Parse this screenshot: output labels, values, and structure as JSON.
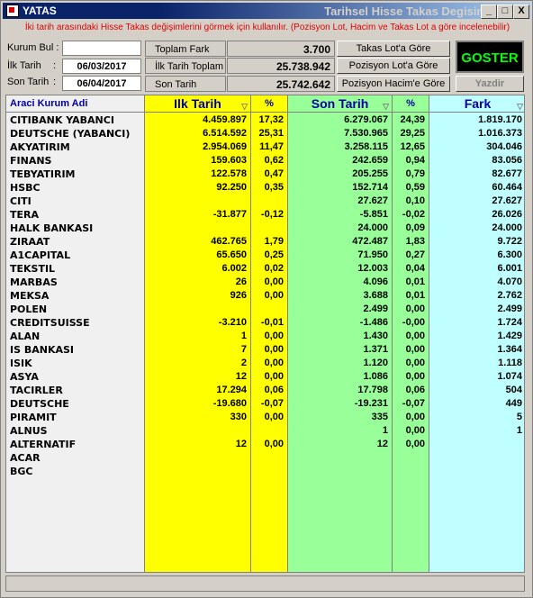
{
  "window": {
    "app_title": "YATAS",
    "title_right": "Tarihsel Hisse Takas Degisim",
    "min_label": "_",
    "max_label": "□",
    "close_label": "X"
  },
  "info_text": "İki tarih arasındaki Hisse Takas değişimlerini görmek için kullanılır. (Pozisyon Lot, Hacim ve Takas Lot a göre incelenebilir)",
  "form": {
    "kurum_label": "Kurum Bul :",
    "kurum_value": "",
    "ilk_label": "İlk Tarih",
    "son_label": "Son Tarih",
    "colon": ":",
    "ilk_value": "06/03/2017",
    "son_value": "06/04/2017"
  },
  "summary": {
    "toplam_fark_label": "Toplam Fark",
    "toplam_fark_value": "3.700",
    "ilk_toplam_label": "İlk Tarih Toplam",
    "ilk_toplam_value": "25.738.942",
    "son_toplam_label": "Son Tarih Toplam",
    "son_toplam_value": "25.742.642"
  },
  "buttons": {
    "takas_lot": "Takas Lot'a Göre",
    "pozisyon_lot": "Pozisyon Lot'a Göre",
    "pozisyon_hacim": "Pozisyon Hacim'e Göre",
    "goster": "GOSTER",
    "yazdir": "Yazdir"
  },
  "columns": {
    "name": "Araci Kurum Adi",
    "ilk": "Ilk Tarih",
    "ilk_pct": "%",
    "son": "Son Tarih",
    "son_pct": "%",
    "fark": "Fark",
    "sort_icon": "▽"
  },
  "rows": [
    {
      "name": "CITIBANK YABANCI",
      "ilk": "4.459.897",
      "ilkp": "17,32",
      "son": "6.279.067",
      "sonp": "24,39",
      "fark": "1.819.170"
    },
    {
      "name": "DEUTSCHE (YABANCI)",
      "ilk": "6.514.592",
      "ilkp": "25,31",
      "son": "7.530.965",
      "sonp": "29,25",
      "fark": "1.016.373"
    },
    {
      "name": "AKYATIRIM",
      "ilk": "2.954.069",
      "ilkp": "11,47",
      "son": "3.258.115",
      "sonp": "12,65",
      "fark": "304.046"
    },
    {
      "name": "FINANS",
      "ilk": "159.603",
      "ilkp": "0,62",
      "son": "242.659",
      "sonp": "0,94",
      "fark": "83.056"
    },
    {
      "name": "TEBYATIRIM",
      "ilk": "122.578",
      "ilkp": "0,47",
      "son": "205.255",
      "sonp": "0,79",
      "fark": "82.677"
    },
    {
      "name": "HSBC",
      "ilk": "92.250",
      "ilkp": "0,35",
      "son": "152.714",
      "sonp": "0,59",
      "fark": "60.464"
    },
    {
      "name": "CITI",
      "ilk": "",
      "ilkp": "",
      "son": "27.627",
      "sonp": "0,10",
      "fark": "27.627"
    },
    {
      "name": "TERA",
      "ilk": "-31.877",
      "ilkp": "-0,12",
      "son": "-5.851",
      "sonp": "-0,02",
      "fark": "26.026"
    },
    {
      "name": "HALK BANKASI",
      "ilk": "",
      "ilkp": "",
      "son": "24.000",
      "sonp": "0,09",
      "fark": "24.000"
    },
    {
      "name": "ZIRAAT",
      "ilk": "462.765",
      "ilkp": "1,79",
      "son": "472.487",
      "sonp": "1,83",
      "fark": "9.722"
    },
    {
      "name": "A1CAPITAL",
      "ilk": "65.650",
      "ilkp": "0,25",
      "son": "71.950",
      "sonp": "0,27",
      "fark": "6.300"
    },
    {
      "name": "TEKSTIL",
      "ilk": "6.002",
      "ilkp": "0,02",
      "son": "12.003",
      "sonp": "0,04",
      "fark": "6.001"
    },
    {
      "name": "MARBAS",
      "ilk": "26",
      "ilkp": "0,00",
      "son": "4.096",
      "sonp": "0,01",
      "fark": "4.070"
    },
    {
      "name": "MEKSA",
      "ilk": "926",
      "ilkp": "0,00",
      "son": "3.688",
      "sonp": "0,01",
      "fark": "2.762"
    },
    {
      "name": "POLEN",
      "ilk": "",
      "ilkp": "",
      "son": "2.499",
      "sonp": "0,00",
      "fark": "2.499"
    },
    {
      "name": "CREDITSUISSE",
      "ilk": "-3.210",
      "ilkp": "-0,01",
      "son": "-1.486",
      "sonp": "-0,00",
      "fark": "1.724"
    },
    {
      "name": "ALAN",
      "ilk": "1",
      "ilkp": "0,00",
      "son": "1.430",
      "sonp": "0,00",
      "fark": "1.429"
    },
    {
      "name": "IS BANKASI",
      "ilk": "7",
      "ilkp": "0,00",
      "son": "1.371",
      "sonp": "0,00",
      "fark": "1.364"
    },
    {
      "name": "ISIK",
      "ilk": "2",
      "ilkp": "0,00",
      "son": "1.120",
      "sonp": "0,00",
      "fark": "1.118"
    },
    {
      "name": "ASYA",
      "ilk": "12",
      "ilkp": "0,00",
      "son": "1.086",
      "sonp": "0,00",
      "fark": "1.074"
    },
    {
      "name": "TACIRLER",
      "ilk": "17.294",
      "ilkp": "0,06",
      "son": "17.798",
      "sonp": "0,06",
      "fark": "504"
    },
    {
      "name": "DEUTSCHE",
      "ilk": "-19.680",
      "ilkp": "-0,07",
      "son": "-19.231",
      "sonp": "-0,07",
      "fark": "449"
    },
    {
      "name": "PIRAMIT",
      "ilk": "330",
      "ilkp": "0,00",
      "son": "335",
      "sonp": "0,00",
      "fark": "5"
    },
    {
      "name": "ALNUS",
      "ilk": "",
      "ilkp": "",
      "son": "1",
      "sonp": "0,00",
      "fark": "1"
    },
    {
      "name": "ALTERNATIF",
      "ilk": "12",
      "ilkp": "0,00",
      "son": "12",
      "sonp": "0,00",
      "fark": ""
    },
    {
      "name": "ACAR",
      "ilk": "",
      "ilkp": "",
      "son": "",
      "sonp": "",
      "fark": ""
    },
    {
      "name": "BGC",
      "ilk": "",
      "ilkp": "",
      "son": "",
      "sonp": "",
      "fark": ""
    }
  ],
  "colors": {
    "ilk_bg": "#ffff00",
    "son_bg": "#99ff99",
    "fark_bg": "#c0ffff",
    "info_text": "#e00000",
    "goster_text": "#00ff00"
  }
}
